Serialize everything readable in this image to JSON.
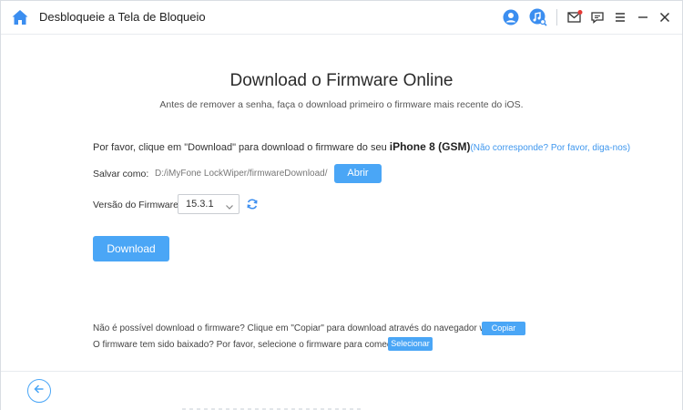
{
  "app": {
    "title": "Desbloqueie a Tela de Bloqueio"
  },
  "toolbar": {
    "icons": [
      "user-icon",
      "music-search-icon",
      "mail-icon",
      "chat-icon",
      "menu-icon",
      "minimize-icon",
      "close-icon"
    ]
  },
  "page": {
    "title": "Download o Firmware Online",
    "subtitle": "Antes de remover a senha, faça o download primeiro o firmware mais recente do iOS."
  },
  "instruction": {
    "prefix": "Por favor, clique em \"Download\" para download o firmware do seu ",
    "device": "iPhone 8 (GSM)",
    "link": "(Não corresponde? Por favor, diga-nos)"
  },
  "save": {
    "label": "Salvar como:",
    "path": "D:/iMyFone LockWiper/firmwareDownload/",
    "open_label": "Abrir"
  },
  "firmware": {
    "label": "Versão do Firmware:",
    "selected": "15.3.1"
  },
  "download_label": "Download",
  "notes": {
    "copy_text": "Não é possível download o firmware? Clique em \"Copiar\" para download através do navegador web.",
    "copy_button": "Copiar",
    "select_text": "O firmware tem sido baixado? Por favor, selecione o firmware para começar.",
    "select_button": "Selecionar"
  },
  "colors": {
    "accent": "#4aa6f6",
    "link": "#3f97ee",
    "mail_badge": "#e53935"
  }
}
